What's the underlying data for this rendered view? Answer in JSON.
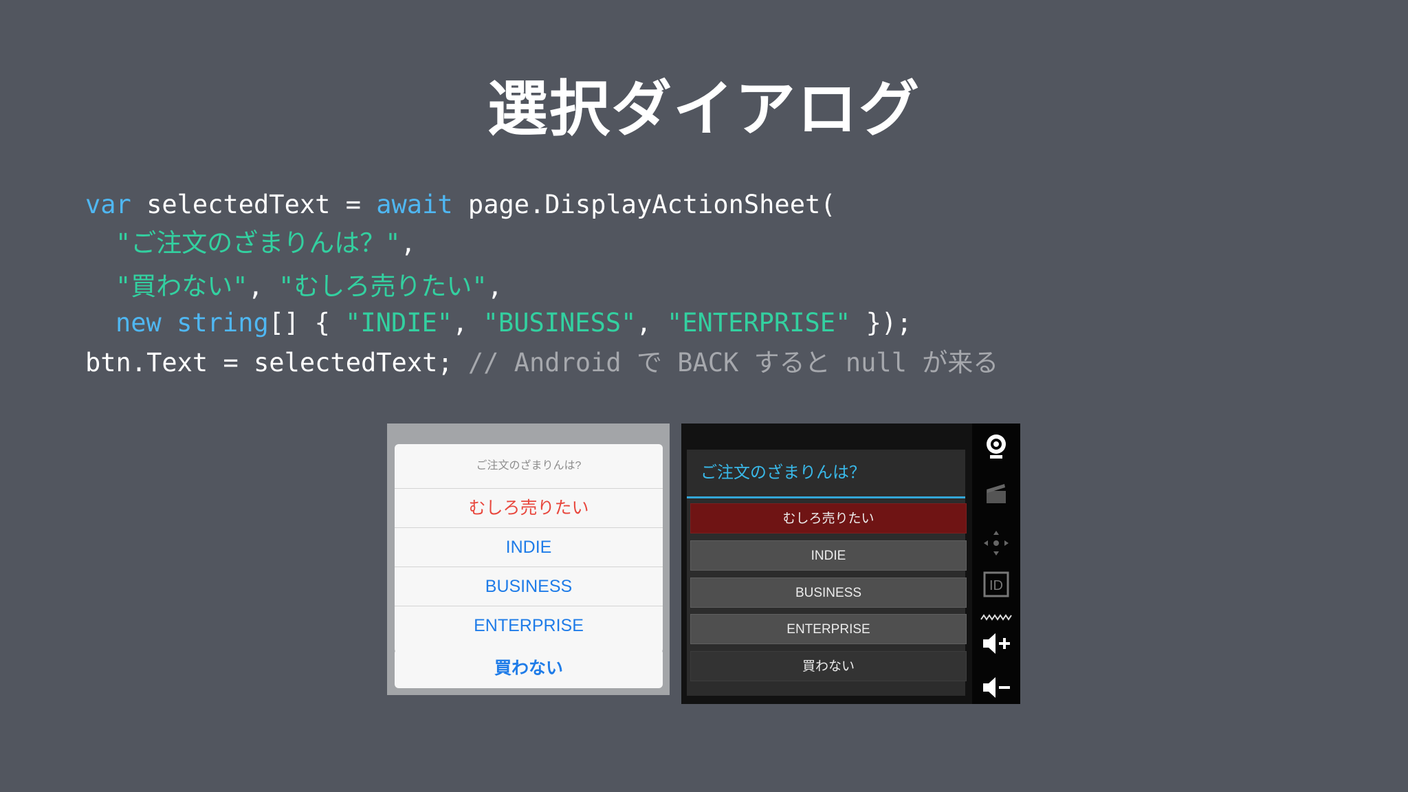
{
  "slide": {
    "title": "選択ダイアログ"
  },
  "code": {
    "l1_var": "var",
    "l1_a": " selectedText = ",
    "l1_await": "await",
    "l1_b": " page.DisplayActionSheet(",
    "l2_str": "\"ご注文のざまりんは？\"",
    "l2_tail": ",",
    "l3_s1": "\"買わない\"",
    "l3_sep": ", ",
    "l3_s2": "\"むしろ売りたい\"",
    "l3_tail": ",",
    "l4_new": "new",
    "l4_sp": " ",
    "l4_string": "string",
    "l4_a": "[] { ",
    "l4_s1": "\"INDIE\"",
    "l4_sep1": ", ",
    "l4_s2": "\"BUSINESS\"",
    "l4_sep2": ", ",
    "l4_s3": "\"ENTERPRISE\"",
    "l4_b": " });",
    "l5_code": "btn.Text = selectedText; ",
    "l5_comment": "// Android で BACK すると null が来る"
  },
  "ios_sheet": {
    "title": "ご注文のざまりんは?",
    "destructive": "むしろ売りたい",
    "buttons": [
      "INDIE",
      "BUSINESS",
      "ENTERPRISE"
    ],
    "cancel": "買わない"
  },
  "android_sheet": {
    "title": "ご注文のざまりんは？",
    "destructive": "むしろ売りたい",
    "buttons": [
      "INDIE",
      "BUSINESS",
      "ENTERPRISE"
    ],
    "cancel": "買わない",
    "rail_icons": [
      "webcam-icon",
      "clapperboard-icon",
      "move-dpad-icon",
      "id-icon",
      "signal-icon",
      "volume-up-icon",
      "volume-down-icon"
    ],
    "rail_id_label": "ID"
  },
  "colors": {
    "background": "#52565f",
    "keyword": "#4fb7f2",
    "string": "#33d0a0",
    "comment": "#a6a8ad",
    "ios_accent": "#1f7ce8",
    "ios_destructive": "#e8473d",
    "android_accent": "#39b8e8",
    "android_destructive": "#6f1414"
  }
}
